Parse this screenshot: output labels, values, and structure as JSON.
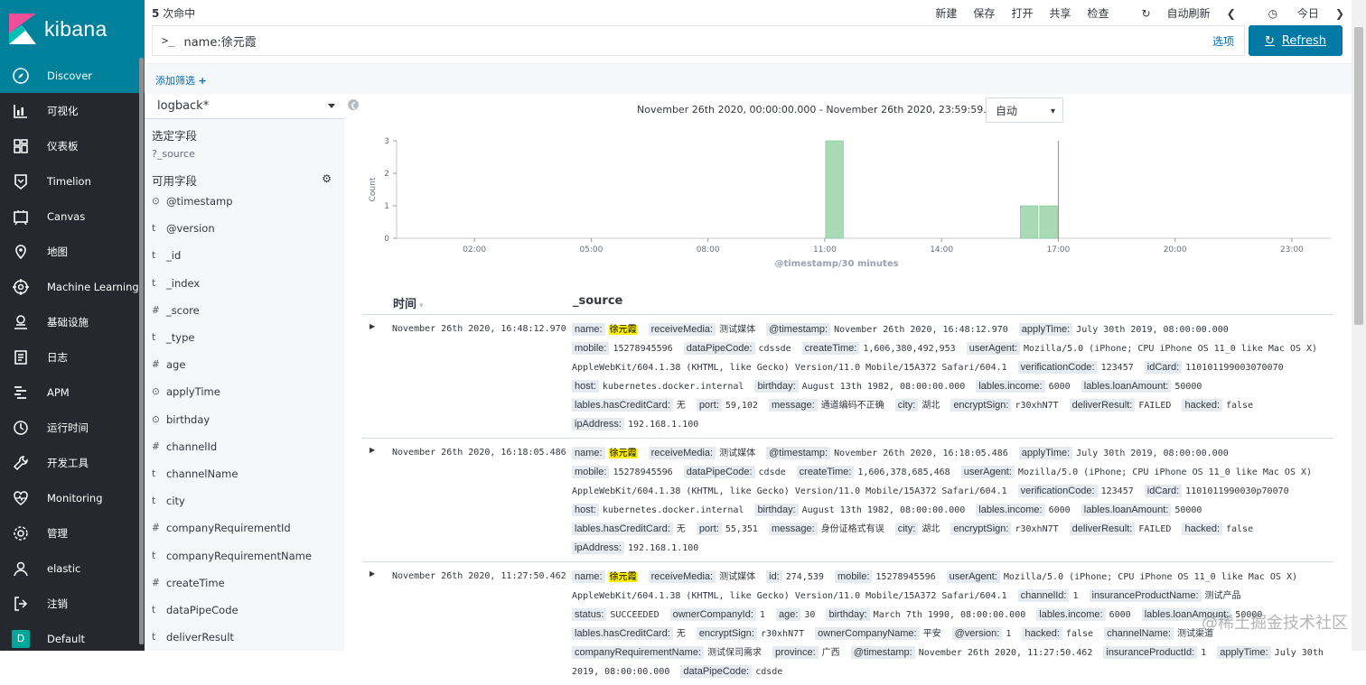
{
  "app": {
    "name": "kibana"
  },
  "sidebar": {
    "items": [
      {
        "label": "Discover",
        "icon": "compass-icon"
      },
      {
        "label": "可视化",
        "icon": "visualize-icon"
      },
      {
        "label": "仪表板",
        "icon": "dashboard-icon"
      },
      {
        "label": "Timelion",
        "icon": "timelion-icon"
      },
      {
        "label": "Canvas",
        "icon": "canvas-icon"
      },
      {
        "label": "地图",
        "icon": "map-icon"
      },
      {
        "label": "Machine Learning",
        "icon": "ml-icon"
      },
      {
        "label": "基础设施",
        "icon": "infrastructure-icon"
      },
      {
        "label": "日志",
        "icon": "logs-icon"
      },
      {
        "label": "APM",
        "icon": "apm-icon"
      },
      {
        "label": "运行时间",
        "icon": "uptime-icon"
      },
      {
        "label": "开发工具",
        "icon": "wrench-icon"
      },
      {
        "label": "Monitoring",
        "icon": "heartbeat-icon"
      },
      {
        "label": "管理",
        "icon": "gear-icon"
      },
      {
        "label": "elastic",
        "icon": "user-icon"
      },
      {
        "label": "注销",
        "icon": "logout-icon"
      },
      {
        "label": "Default",
        "icon": "space-badge",
        "badge": "D"
      }
    ]
  },
  "topbar": {
    "hits_count": "5",
    "hits_label": " 次命中",
    "menu": {
      "new": "新建",
      "save": "保存",
      "open": "打开",
      "share": "共享",
      "inspect": "检查",
      "autorefresh": "自动刷新",
      "today": "今日"
    }
  },
  "query": {
    "prompt": ">_",
    "value": "name:徐元霞",
    "options": "选项",
    "refresh": "Refresh"
  },
  "filter": {
    "add": "添加筛选"
  },
  "fields": {
    "index_pattern": "logback*",
    "selected_title": "选定字段",
    "selected": [
      {
        "type": "?",
        "name": "_source"
      }
    ],
    "available_title": "可用字段",
    "available": [
      {
        "type": "⊙",
        "name": "@timestamp"
      },
      {
        "type": "t",
        "name": "@version"
      },
      {
        "type": "t",
        "name": "_id"
      },
      {
        "type": "t",
        "name": "_index"
      },
      {
        "type": "#",
        "name": "_score"
      },
      {
        "type": "t",
        "name": "_type"
      },
      {
        "type": "#",
        "name": "age"
      },
      {
        "type": "⊙",
        "name": "applyTime"
      },
      {
        "type": "⊙",
        "name": "birthday"
      },
      {
        "type": "#",
        "name": "channelId"
      },
      {
        "type": "t",
        "name": "channelName"
      },
      {
        "type": "t",
        "name": "city"
      },
      {
        "type": "#",
        "name": "companyRequirementId"
      },
      {
        "type": "t",
        "name": "companyRequirementName"
      },
      {
        "type": "#",
        "name": "createTime"
      },
      {
        "type": "t",
        "name": "dataPipeCode"
      },
      {
        "type": "t",
        "name": "deliverResult"
      }
    ]
  },
  "histogram": {
    "time_range": "November 26th 2020, 00:00:00.000 - November 26th 2020, 23:59:59.999 —",
    "interval": "自动"
  },
  "chart_data": {
    "type": "bar",
    "xlabel": "@timestamp/30 minutes",
    "ylabel": "Count",
    "ylim": [
      0,
      3
    ],
    "yticks": [
      "0",
      "1",
      "2",
      "3"
    ],
    "xlim_hours": [
      0,
      24
    ],
    "xticks": [
      "02:00",
      "05:00",
      "08:00",
      "11:00",
      "14:00",
      "17:00",
      "20:00",
      "23:00"
    ],
    "bars": [
      {
        "start_hour": 11.0,
        "value": 3
      },
      {
        "start_hour": 16.0,
        "value": 1
      },
      {
        "start_hour": 16.5,
        "value": 1
      }
    ],
    "now_marker_hour": 17.0,
    "bar_color": "#a8dbb5",
    "marker_color": "#e36d6d"
  },
  "table": {
    "col_time": "时间",
    "col_source": "_source",
    "rows": [
      {
        "time": "November 26th 2020, 16:48:12.970",
        "fields": [
          {
            "k": "name:",
            "v": "徐元霞",
            "hl": true
          },
          {
            "k": "receiveMedia:",
            "v": "测试媒体"
          },
          {
            "k": "@timestamp:",
            "v": "November 26th 2020, 16:48:12.970"
          },
          {
            "k": "applyTime:",
            "v": "July 30th 2019, 08:00:00.000"
          },
          {
            "k": "mobile:",
            "v": "15278945596"
          },
          {
            "k": "dataPipeCode:",
            "v": "cdssde"
          },
          {
            "k": "createTime:",
            "v": "1,606,380,492,953"
          },
          {
            "k": "userAgent:",
            "v": "Mozilla/5.0 (iPhone; CPU iPhone OS 11_0 like Mac OS X) AppleWebKit/604.1.38 (KHTML, like Gecko) Version/11.0 Mobile/15A372 Safari/604.1"
          },
          {
            "k": "verificationCode:",
            "v": "123457"
          },
          {
            "k": "idCard:",
            "v": "110101199003070070"
          },
          {
            "k": "host:",
            "v": "kubernetes.docker.internal"
          },
          {
            "k": "birthday:",
            "v": "August 13th 1982, 08:00:00.000"
          },
          {
            "k": "lables.income:",
            "v": "6000"
          },
          {
            "k": "lables.loanAmount:",
            "v": "50000"
          },
          {
            "k": "lables.hasCreditCard:",
            "v": "无"
          },
          {
            "k": "port:",
            "v": "59,102"
          },
          {
            "k": "message:",
            "v": "通道编码不正确"
          },
          {
            "k": "city:",
            "v": "湖北"
          },
          {
            "k": "encryptSign:",
            "v": "r30xhN7T"
          },
          {
            "k": "deliverResult:",
            "v": "FAILED"
          },
          {
            "k": "hacked:",
            "v": "false"
          },
          {
            "k": "ipAddress:",
            "v": "192.168.1.100"
          }
        ]
      },
      {
        "time": "November 26th 2020, 16:18:05.486",
        "fields": [
          {
            "k": "name:",
            "v": "徐元霞",
            "hl": true
          },
          {
            "k": "receiveMedia:",
            "v": "测试媒体"
          },
          {
            "k": "@timestamp:",
            "v": "November 26th 2020, 16:18:05.486"
          },
          {
            "k": "applyTime:",
            "v": "July 30th 2019, 08:00:00.000"
          },
          {
            "k": "mobile:",
            "v": "15278945596"
          },
          {
            "k": "dataPipeCode:",
            "v": "cdsde"
          },
          {
            "k": "createTime:",
            "v": "1,606,378,685,468"
          },
          {
            "k": "userAgent:",
            "v": "Mozilla/5.0 (iPhone; CPU iPhone OS 11_0 like Mac OS X) AppleWebKit/604.1.38 (KHTML, like Gecko) Version/11.0 Mobile/15A372 Safari/604.1"
          },
          {
            "k": "verificationCode:",
            "v": "123457"
          },
          {
            "k": "idCard:",
            "v": "1101011990030p70070"
          },
          {
            "k": "host:",
            "v": "kubernetes.docker.internal"
          },
          {
            "k": "birthday:",
            "v": "August 13th 1982, 08:00:00.000"
          },
          {
            "k": "lables.income:",
            "v": "6000"
          },
          {
            "k": "lables.loanAmount:",
            "v": "50000"
          },
          {
            "k": "lables.hasCreditCard:",
            "v": "无"
          },
          {
            "k": "port:",
            "v": "55,351"
          },
          {
            "k": "message:",
            "v": "身份证格式有误"
          },
          {
            "k": "city:",
            "v": "湖北"
          },
          {
            "k": "encryptSign:",
            "v": "r30xhN7T"
          },
          {
            "k": "deliverResult:",
            "v": "FAILED"
          },
          {
            "k": "hacked:",
            "v": "false"
          },
          {
            "k": "ipAddress:",
            "v": "192.168.1.100"
          }
        ]
      },
      {
        "time": "November 26th 2020, 11:27:50.462",
        "fields": [
          {
            "k": "name:",
            "v": "徐元霞",
            "hl": true
          },
          {
            "k": "receiveMedia:",
            "v": "测试媒体"
          },
          {
            "k": "id:",
            "v": "274,539"
          },
          {
            "k": "mobile:",
            "v": "15278945596"
          },
          {
            "k": "userAgent:",
            "v": "Mozilla/5.0 (iPhone; CPU iPhone OS 11_0 like Mac OS X) AppleWebKit/604.1.38 (KHTML, like Gecko) Version/11.0 Mobile/15A372 Safari/604.1"
          },
          {
            "k": "channelId:",
            "v": "1"
          },
          {
            "k": "insuranceProductName:",
            "v": "测试产品"
          },
          {
            "k": "status:",
            "v": "SUCCEEDED"
          },
          {
            "k": "ownerCompanyId:",
            "v": "1"
          },
          {
            "k": "age:",
            "v": "30"
          },
          {
            "k": "birthday:",
            "v": "March 7th 1990, 08:00:00.000"
          },
          {
            "k": "lables.income:",
            "v": "6000"
          },
          {
            "k": "lables.loanAmount:",
            "v": "50000"
          },
          {
            "k": "lables.hasCreditCard:",
            "v": "无"
          },
          {
            "k": "encryptSign:",
            "v": "r30xhN7T"
          },
          {
            "k": "ownerCompanyName:",
            "v": "平安"
          },
          {
            "k": "@version:",
            "v": "1"
          },
          {
            "k": "hacked:",
            "v": "false"
          },
          {
            "k": "channelName:",
            "v": "测试渠道"
          },
          {
            "k": "companyRequirementName:",
            "v": "测试保司需求"
          },
          {
            "k": "province:",
            "v": "广西"
          },
          {
            "k": "@timestamp:",
            "v": "November 26th 2020, 11:27:50.462"
          },
          {
            "k": "insuranceProductId:",
            "v": "1"
          },
          {
            "k": "applyTime:",
            "v": "July 30th 2019, 08:00:00.000"
          },
          {
            "k": "dataPipeCode:",
            "v": "cdsde"
          }
        ]
      }
    ]
  },
  "watermark": "@稀土掘金技术社区"
}
